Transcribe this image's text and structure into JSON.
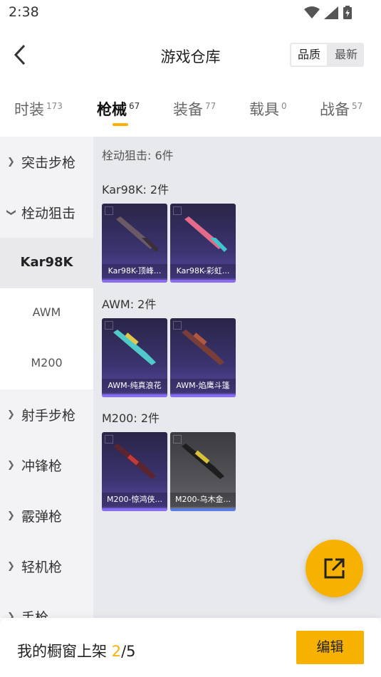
{
  "status": {
    "time": "2:38"
  },
  "header": {
    "title": "游戏仓库",
    "sort_quality": "品质",
    "sort_latest": "最新"
  },
  "tabs": [
    {
      "label": "时装",
      "count": "173"
    },
    {
      "label": "枪械",
      "count": "67"
    },
    {
      "label": "装备",
      "count": "77"
    },
    {
      "label": "载具",
      "count": "0"
    },
    {
      "label": "战备",
      "count": "57"
    }
  ],
  "sidebar": {
    "assault": "突击步枪",
    "bolt": "栓动狙击",
    "sub_kar": "Kar98K",
    "sub_awm": "AWM",
    "sub_m200": "M200",
    "marksman": "射手步枪",
    "smg": "冲锋枪",
    "shotgun": "霰弹枪",
    "lmg": "轻机枪",
    "pistol": "手枪"
  },
  "content": {
    "category_header": "栓动狙击: 6件",
    "groups": [
      {
        "title": "Kar98K: 2件",
        "items": [
          "Kar98K-顶峰...",
          "Kar98K-彩虹..."
        ]
      },
      {
        "title": "AWM: 2件",
        "items": [
          "AWM-纯真浪花",
          "AWM-焰鹰斗篷"
        ]
      },
      {
        "title": "M200: 2件",
        "items": [
          "M200-惊鸿侠...",
          "M200-乌木金..."
        ]
      }
    ]
  },
  "bottom": {
    "shelf_label": "我的橱窗上架",
    "current": "2",
    "total": "/5",
    "edit": "编辑"
  },
  "colors": {
    "accent": "#f7b100",
    "card_purple": "#3b3470",
    "card_gray": "#56565b"
  }
}
